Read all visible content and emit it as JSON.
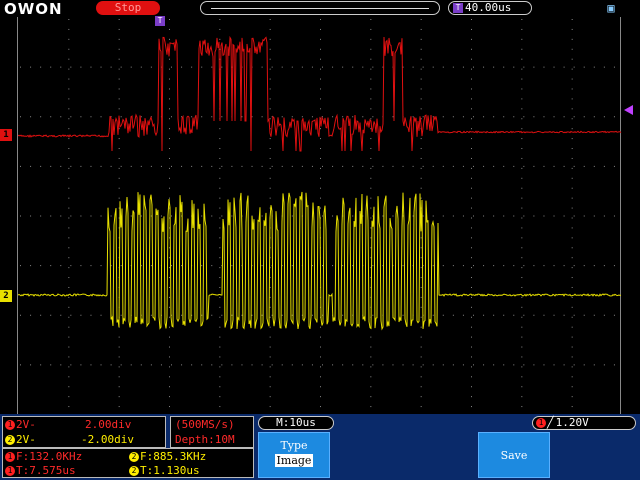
{
  "topbar": {
    "brand": "OWON",
    "run_state": "Stop",
    "timebase_icon": "T",
    "timebase_value": "40.00us",
    "menu_icon": "menu-square-icon"
  },
  "markers": {
    "ch1": "1",
    "ch2": "2",
    "trigger_pos": "T"
  },
  "channel_settings": {
    "ch1_num": "1",
    "ch1_coupling": "2V-",
    "ch1_scale": "2.00div",
    "ch2_num": "2",
    "ch2_coupling": "2V-",
    "ch2_scale": "-2.00div"
  },
  "sampling": {
    "rate": "(500MS/s)",
    "depth": "Depth:10M"
  },
  "measurements": {
    "ch1_freq": "F:132.0KHz",
    "ch2_freq": "F:885.3KHz",
    "ch1_period": "T:7.575us",
    "ch2_period": "T:1.130us"
  },
  "horizontal": {
    "main_timebase": "M:10us"
  },
  "trigger": {
    "source_num": "1",
    "edge_symbol": "╱",
    "level": "1.20V"
  },
  "menu": {
    "type_title": "Type",
    "type_value": "Image",
    "save_label": "Save"
  },
  "colors": {
    "ch1": "#e01010",
    "ch2": "#e8e000",
    "run_state_bg": "#e01010",
    "softkey": "#1d8ae0",
    "panel": "#0a2a6a"
  }
}
